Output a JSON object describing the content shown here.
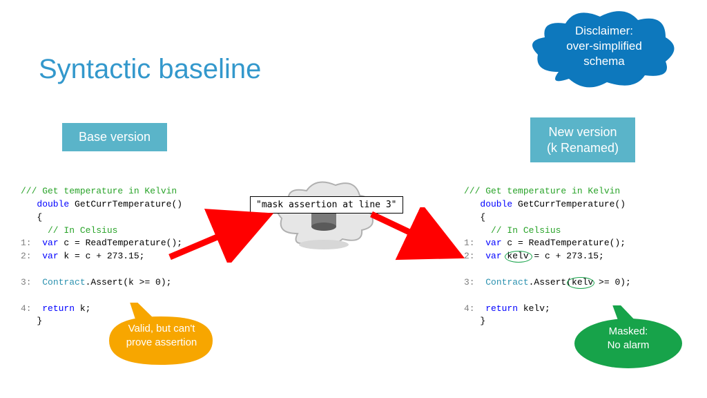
{
  "title": "Syntactic baseline",
  "disclaimer": "Disclaimer:\nover-simplified\nschema",
  "labels": {
    "base": "Base version",
    "new": "New version\n(k Renamed)"
  },
  "mask_note": "\"mask assertion at line 3\"",
  "callouts": {
    "yellow": "Valid, but can't\nprove assertion",
    "green": "Masked:\nNo alarm"
  },
  "code_left": {
    "comment_top": "/// Get temperature in Kelvin",
    "sig_kw": "double",
    "sig_name": " GetCurrTemperature()",
    "brace_open": "{",
    "comment_in": "  // In Celsius",
    "l1": "1:",
    "l1_kw": "  var",
    "l1_rest": " c = ReadTemperature();",
    "l2": "2:",
    "l2_kw": "  var",
    "l2_rest": " k = c + 273.15;",
    "l3": "3:",
    "l3_typ": "  Contract",
    "l3_rest": ".Assert(k >= 0);",
    "l4": "4:",
    "l4_kw": "  return",
    "l4_rest": " k;",
    "brace_close": "   }"
  },
  "code_right": {
    "comment_top": "/// Get temperature in Kelvin",
    "sig_kw": "double",
    "sig_name": " GetCurrTemperature()",
    "brace_open": "{",
    "comment_in": "  // In Celsius",
    "l1": "1:",
    "l1_kw": "  var",
    "l1_rest": " c = ReadTemperature();",
    "l2": "2:",
    "l2_kw": "  var",
    "l2_rest": " kelv = c + 273.15;",
    "l3": "3:",
    "l3_typ": "  Contract",
    "l3_rest": ".Assert(kelv >= 0);",
    "l4": "4:",
    "l4_kw": "  return",
    "l4_rest": " kelv;",
    "brace_close": "   }"
  }
}
